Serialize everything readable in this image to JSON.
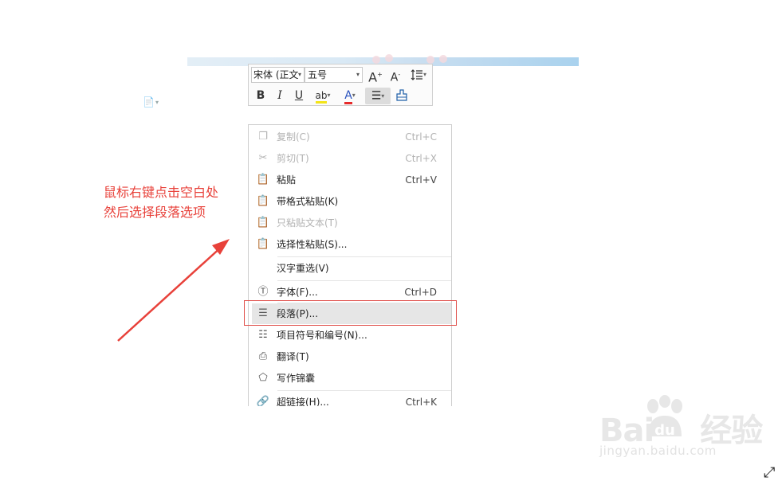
{
  "mini_toolbar": {
    "font_name": "宋体 (正文",
    "font_size": "五号",
    "grow_font": "A",
    "shrink_font": "A",
    "bold": "B",
    "italic": "I",
    "underline": "U",
    "highlight": "ab",
    "font_color": "A"
  },
  "context_menu": {
    "items": [
      {
        "label": "复制(C)",
        "shortcut": "Ctrl+C",
        "icon": "copy-icon"
      },
      {
        "label": "剪切(T)",
        "shortcut": "Ctrl+X",
        "icon": "scissors-icon"
      },
      {
        "label": "粘贴",
        "shortcut": "Ctrl+V",
        "icon": "paste-icon"
      },
      {
        "label": "带格式粘贴(K)",
        "shortcut": "",
        "icon": "paste-format-icon"
      },
      {
        "label": "只粘贴文本(T)",
        "shortcut": "",
        "icon": "paste-text-icon"
      },
      {
        "label": "选择性粘贴(S)...",
        "shortcut": "",
        "icon": "paste-special-icon"
      },
      {
        "label": "汉字重选(V)",
        "shortcut": "",
        "icon": ""
      },
      {
        "label": "字体(F)...",
        "shortcut": "Ctrl+D",
        "icon": "font-icon"
      },
      {
        "label": "段落(P)...",
        "shortcut": "",
        "icon": "paragraph-icon"
      },
      {
        "label": "项目符号和编号(N)...",
        "shortcut": "",
        "icon": "bullets-icon"
      },
      {
        "label": "翻译(T)",
        "shortcut": "",
        "icon": "translate-icon"
      },
      {
        "label": "写作锦囊",
        "shortcut": "",
        "icon": "writing-icon"
      },
      {
        "label": "超链接(H)...",
        "shortcut": "Ctrl+K",
        "icon": "link-icon"
      }
    ]
  },
  "annotation": {
    "line1": "鼠标右键点击空白处",
    "line2": "然后选择段落选项"
  },
  "watermark": {
    "logo_left": "Bai",
    "logo_right": "经验",
    "url": "jingyan.baidu.com"
  },
  "colors": {
    "annotation_red": "#e8413a",
    "highlight_gray": "#e6e6e6",
    "disabled_text": "#b2b2b2"
  }
}
